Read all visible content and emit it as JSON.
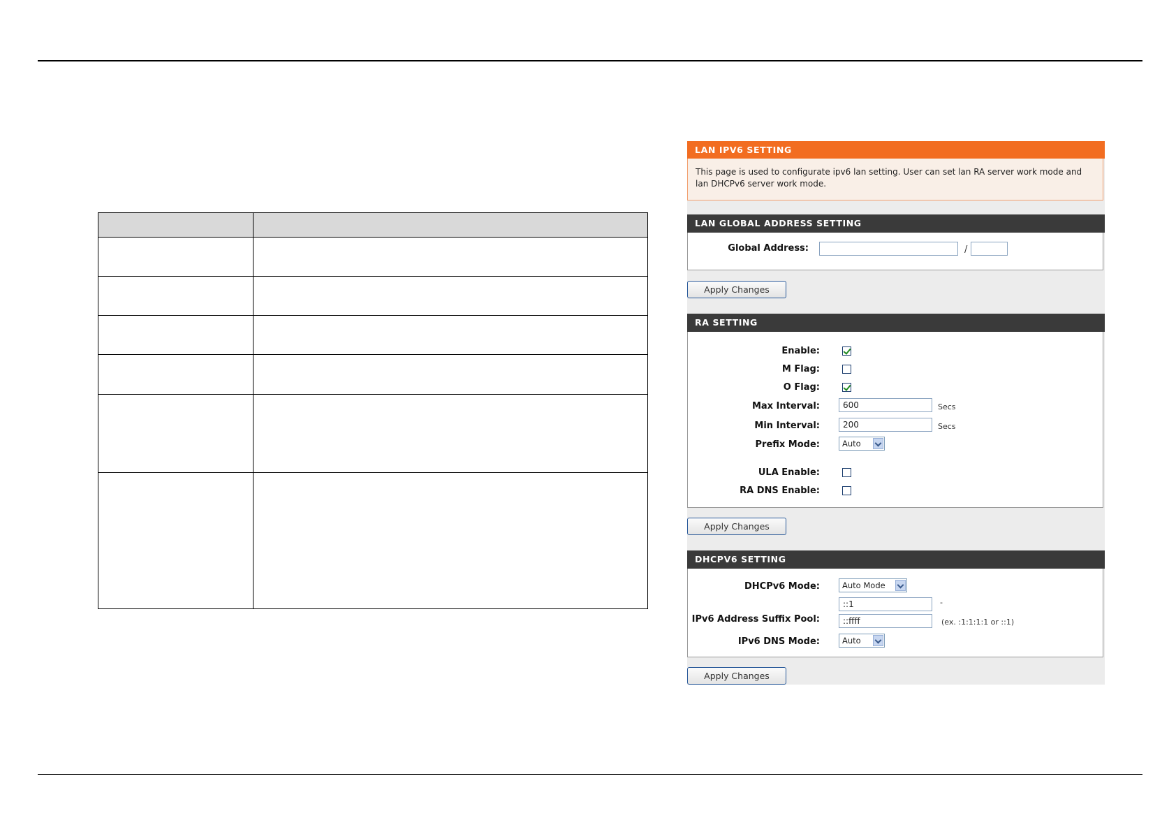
{
  "lan_ipv6_setting": {
    "title": "LAN IPV6 SETTING",
    "description": "This page is used to configurate ipv6 lan setting. User can set lan RA server work mode and lan DHCPv6 server work mode."
  },
  "global_address_setting": {
    "title": "LAN GLOBAL ADDRESS SETTING",
    "global_address_label": "Global Address:",
    "global_address_value": "",
    "prefix_length_value": "",
    "slash": "/",
    "apply_label": "Apply Changes"
  },
  "ra_setting": {
    "title": "RA SETTING",
    "enable_label": "Enable:",
    "enable_checked": true,
    "m_flag_label": "M Flag:",
    "m_flag_checked": false,
    "o_flag_label": "O Flag:",
    "o_flag_checked": true,
    "max_interval_label": "Max Interval:",
    "max_interval_value": "600",
    "max_interval_unit": "Secs",
    "min_interval_label": "Min Interval:",
    "min_interval_value": "200",
    "min_interval_unit": "Secs",
    "prefix_mode_label": "Prefix Mode:",
    "prefix_mode_value": "Auto",
    "ula_enable_label": "ULA Enable:",
    "ula_enable_checked": false,
    "ra_dns_enable_label": "RA DNS Enable:",
    "ra_dns_enable_checked": false,
    "apply_label": "Apply Changes"
  },
  "dhcpv6_setting": {
    "title": "DHCPV6 SETTING",
    "mode_label": "DHCPv6 Mode:",
    "mode_value": "Auto Mode",
    "suffix_pool_label": "IPv6 Address Suffix Pool:",
    "suffix_start_value": "::1",
    "suffix_dash": "-",
    "suffix_end_value": "::ffff",
    "suffix_example": "(ex. :1:1:1:1 or ::1)",
    "dns_mode_label": "IPv6 DNS Mode:",
    "dns_mode_value": "Auto",
    "apply_label": "Apply Changes"
  }
}
